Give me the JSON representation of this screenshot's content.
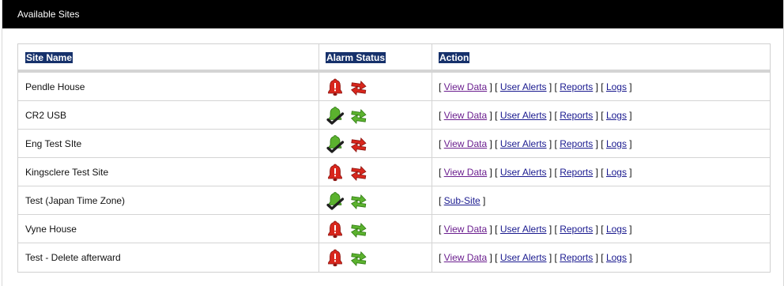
{
  "panel": {
    "title": "Available Sites"
  },
  "table": {
    "headers": {
      "site": "Site Name",
      "alarm": "Alarm Status",
      "action": "Action"
    },
    "rows": [
      {
        "name": "Pendle House",
        "alarm": "bell-alarm-icon",
        "comms": "comms-fail-icon",
        "actions": [
          "View Data",
          "User Alerts",
          "Reports",
          "Logs"
        ]
      },
      {
        "name": "CR2 USB",
        "alarm": "bell-ok-icon",
        "comms": "comms-ok-icon",
        "actions": [
          "View Data",
          "User Alerts",
          "Reports",
          "Logs"
        ]
      },
      {
        "name": "Eng Test SIte",
        "alarm": "bell-ok-icon",
        "comms": "comms-fail-icon",
        "actions": [
          "View Data",
          "User Alerts",
          "Reports",
          "Logs"
        ]
      },
      {
        "name": "Kingsclere Test Site",
        "alarm": "bell-alarm-icon",
        "comms": "comms-fail-icon",
        "actions": [
          "View Data",
          "User Alerts",
          "Reports",
          "Logs"
        ]
      },
      {
        "name": "Test (Japan Time Zone)",
        "alarm": "bell-ok-icon",
        "comms": "comms-ok-icon",
        "actions": [
          "Sub-Site"
        ]
      },
      {
        "name": "Vyne House",
        "alarm": "bell-alarm-icon",
        "comms": "comms-ok-icon",
        "actions": [
          "View Data",
          "User Alerts",
          "Reports",
          "Logs"
        ]
      },
      {
        "name": "Test - Delete afterward",
        "alarm": "bell-alarm-icon",
        "comms": "comms-ok-icon",
        "actions": [
          "View Data",
          "User Alerts",
          "Reports",
          "Logs"
        ]
      }
    ]
  },
  "colors": {
    "titlebar": "#000000",
    "header_highlight": "#16316b",
    "link": "#1a1a8f",
    "link_visited": "#6b1f8f",
    "alarm_red": "#d8261c",
    "ok_green": "#5bb22e"
  }
}
